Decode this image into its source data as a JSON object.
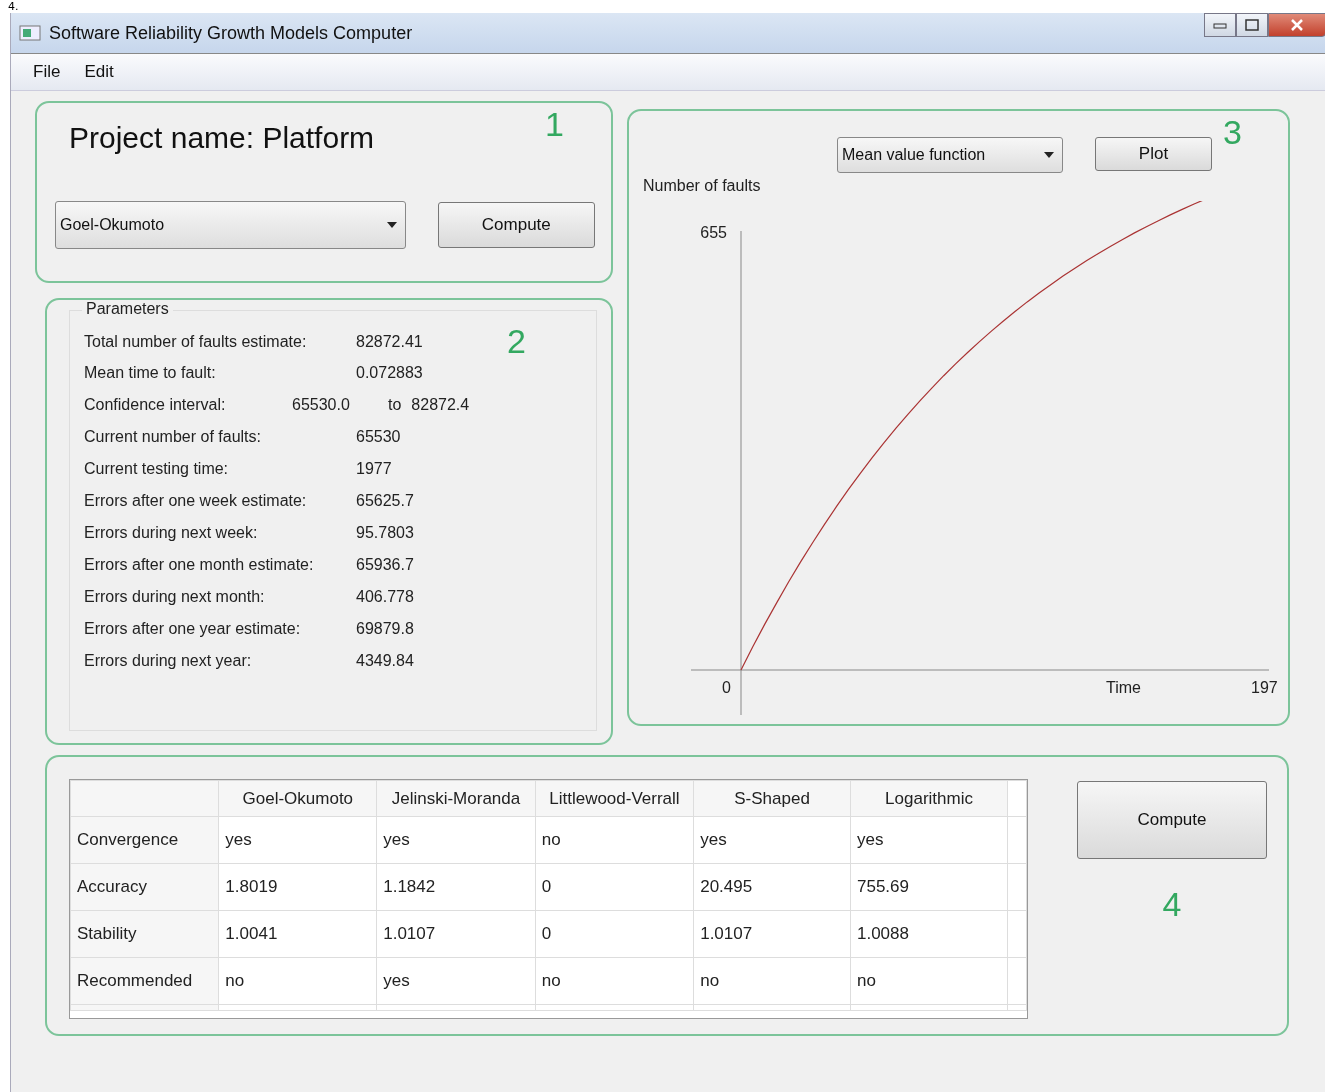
{
  "caption": "4.",
  "window": {
    "title": "Software Reliability Growth Models Computer"
  },
  "menu": [
    "File",
    "Edit"
  ],
  "project_panel": {
    "number": "1",
    "title": "Project name: Platform",
    "model": "Goel-Okumoto",
    "button": "Compute"
  },
  "parameters_panel": {
    "number": "2",
    "title": "Parameters",
    "rows": [
      {
        "label": "Total number of faults estimate:",
        "value": "82872.41"
      },
      {
        "label": "Mean time to fault:",
        "value": "0.072883"
      },
      {
        "label": "Confidence interval:",
        "value": "65530.0",
        "to": "to",
        "value_2": "82872.4"
      },
      {
        "label": "Current number of faults:",
        "value": "65530"
      },
      {
        "label": "Current testing time:",
        "value": "1977"
      },
      {
        "label": "Errors after one week estimate:",
        "value": "65625.7"
      },
      {
        "label": "Errors during next week:",
        "value": "95.7803"
      },
      {
        "label": "Errors after one month estimate:",
        "value": "65936.7"
      },
      {
        "label": "Errors during next month:",
        "value": "406.778"
      },
      {
        "label": "Errors after one year estimate:",
        "value": "69879.8"
      },
      {
        "label": "Errors during next year:",
        "value": "4349.84"
      }
    ]
  },
  "plot_panel": {
    "number": "3",
    "function": "Mean value function",
    "button": "Plot",
    "y_label": "Number of faults",
    "y_max": "655",
    "x_min": "0",
    "x_label": "Time",
    "x_max": "197"
  },
  "comparison_panel": {
    "number": "4",
    "button": "Compute",
    "table": {
      "columns": [
        "Goel-Okumoto",
        "Jelinski-Moranda",
        "Littlewood-Verrall",
        "S-Shaped",
        "Logarithmic"
      ],
      "rows": [
        {
          "header": "Convergence",
          "cells": [
            "yes",
            "yes",
            "no",
            "yes",
            "yes"
          ]
        },
        {
          "header": "Accuracy",
          "cells": [
            "1.8019",
            "1.1842",
            "0",
            "20.495",
            "755.69"
          ]
        },
        {
          "header": "Stability",
          "cells": [
            "1.0041",
            "1.0107",
            "0",
            "1.0107",
            "1.0088"
          ]
        },
        {
          "header": "Recommended",
          "cells": [
            "no",
            "yes",
            "no",
            "no",
            "no"
          ]
        }
      ]
    }
  }
}
